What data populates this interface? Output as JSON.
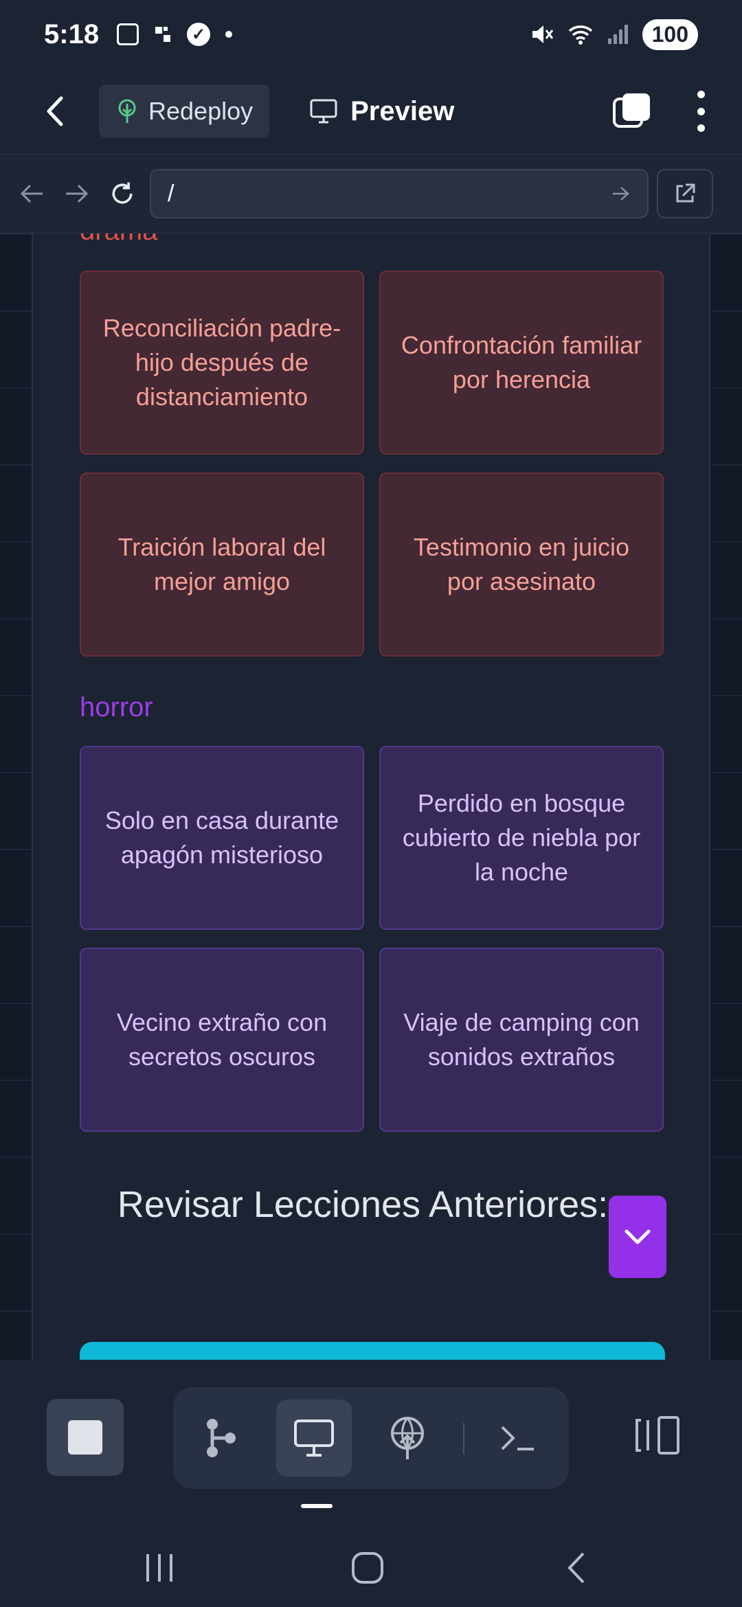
{
  "status_bar": {
    "time": "5:18",
    "battery": "100"
  },
  "header": {
    "redeploy_label": "Redeploy",
    "preview_label": "Preview"
  },
  "browser": {
    "url": "/"
  },
  "categories": {
    "drama": {
      "title": "drama",
      "color": "#e0524b",
      "cards": [
        "Reconciliación padre-hijo después de distanciamiento",
        "Confrontación familiar por herencia",
        "Traición laboral del mejor amigo",
        "Testimonio en juicio por asesinato"
      ]
    },
    "horror": {
      "title": "horror",
      "color": "#9b3de8",
      "cards": [
        "Solo en casa durante apagón misterioso",
        "Perdido en bosque cubierto de niebla por la noche",
        "Vecino extraño con secretos oscuros",
        "Viaje de camping con sonidos extraños"
      ]
    }
  },
  "review": {
    "title": "Revisar Lecciones Anteriores:"
  },
  "toolbar": {
    "accent": "#9330e8"
  }
}
